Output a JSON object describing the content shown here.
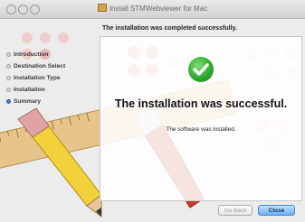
{
  "window": {
    "title": "Install STMWebviewer for Mac"
  },
  "header": {
    "status": "The installation was completed successfully."
  },
  "sidebar": {
    "items": [
      {
        "label": "Introduction",
        "active": false
      },
      {
        "label": "Destination Select",
        "active": false
      },
      {
        "label": "Installation Type",
        "active": false
      },
      {
        "label": "Installation",
        "active": false
      },
      {
        "label": "Summary",
        "active": true
      }
    ]
  },
  "main": {
    "headline": "The installation was successful.",
    "message": "The software was installed."
  },
  "buttons": {
    "back_label": "Go Back",
    "close_label": "Close"
  },
  "colors": {
    "success_green": "#2aa52a",
    "active_bullet": "#3d7be0",
    "default_button": "#6fb1f5"
  }
}
